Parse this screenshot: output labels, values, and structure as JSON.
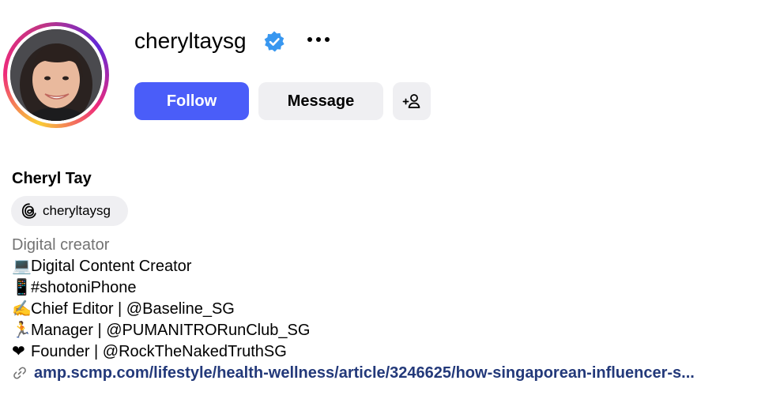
{
  "profile": {
    "username": "cheryltaysg",
    "verified": true,
    "full_name": "Cheryl Tay",
    "threads_handle": "cheryltaysg",
    "category": "Digital creator",
    "bio_lines": [
      {
        "emoji": "💻",
        "text": "Digital Content Creator"
      },
      {
        "emoji": "📱",
        "text": "#shotoniPhone"
      },
      {
        "emoji": "✍️",
        "text": "Chief Editor | @Baseline_SG"
      },
      {
        "emoji": "🏃",
        "text": "Manager | @PUMANITRORunClub_SG"
      },
      {
        "emoji": "❤",
        "text": "Founder | @RockTheNakedTruthSG"
      }
    ],
    "link_text": "amp.scmp.com/lifestyle/health-wellness/article/3246625/how-singaporean-influencer-s..."
  },
  "actions": {
    "follow_label": "Follow",
    "message_label": "Message"
  },
  "icons": {
    "verified": "verified-badge-icon",
    "more": "more-options-icon",
    "suggest": "add-person-icon",
    "threads": "threads-icon",
    "link": "link-icon"
  },
  "colors": {
    "primary_button": "#4a5df9",
    "secondary_button": "#efeff2",
    "verified_badge": "#3897f0",
    "link": "#23397a",
    "muted_text": "#737373"
  }
}
